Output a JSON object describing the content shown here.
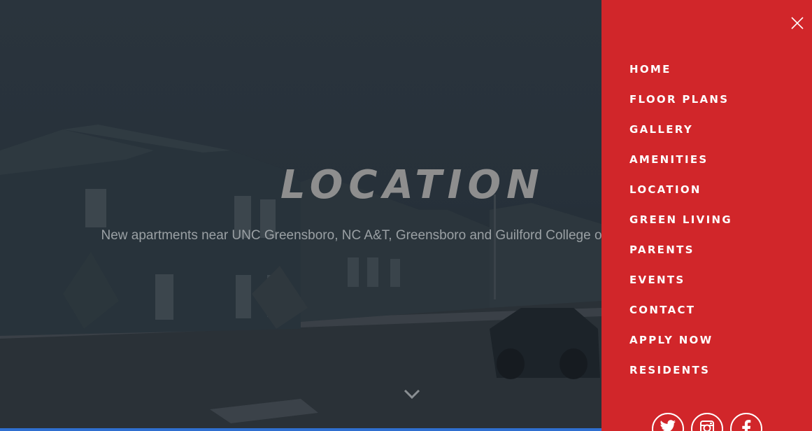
{
  "hero": {
    "title": "LOCATION",
    "subtitle": "New apartments near UNC Greensboro, NC A&T, Greensboro and Guilford College offer college students.",
    "scroll_icon": "chevron-down-icon"
  },
  "menu": {
    "close_icon": "close-icon",
    "items": [
      {
        "label": "HOME"
      },
      {
        "label": "FLOOR PLANS"
      },
      {
        "label": "GALLERY"
      },
      {
        "label": "AMENITIES"
      },
      {
        "label": "LOCATION"
      },
      {
        "label": "GREEN LIVING"
      },
      {
        "label": "PARENTS"
      },
      {
        "label": "EVENTS"
      },
      {
        "label": "CONTACT"
      },
      {
        "label": "APPLY NOW"
      },
      {
        "label": "RESIDENTS"
      }
    ],
    "social": [
      "twitter-icon",
      "instagram-icon",
      "facebook-icon"
    ]
  },
  "colors": {
    "accent": "#d1262a",
    "overlay": "#1f2a33",
    "title": "#8e8e8e"
  }
}
